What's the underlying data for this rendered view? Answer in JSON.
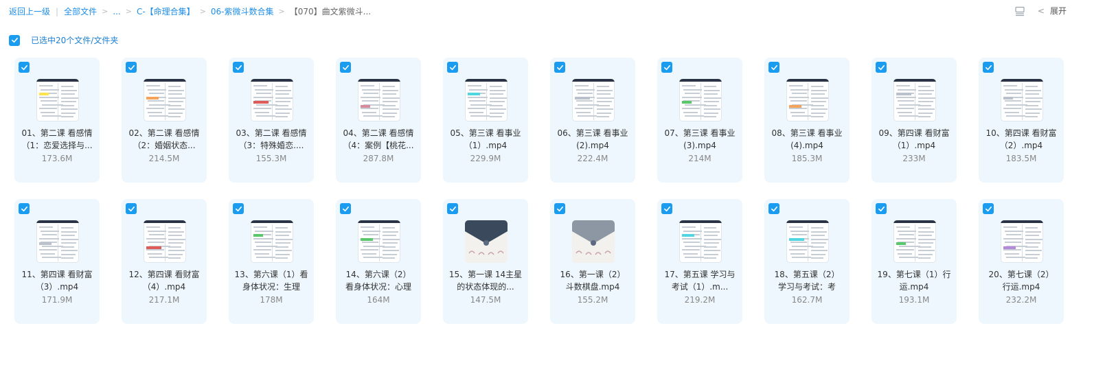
{
  "breadcrumb": {
    "back": "返回上一级",
    "all_files": "全部文件",
    "ellipsis": "...",
    "folder1": "C-【命理合集】",
    "folder2": "06-紫微斗数合集",
    "current": "【070】曲文紫微斗..."
  },
  "toolbar": {
    "expand": "展开"
  },
  "selection": {
    "text": "已选中20个文件/文件夹"
  },
  "files": [
    {
      "line1": "01、第二课 看感情",
      "line2": "（1：恋爱选择与...",
      "size": "173.6M",
      "thumb": "doc-yellow"
    },
    {
      "line1": "02、第二课 看感情",
      "line2": "（2：婚姻状态...",
      "size": "214.5M",
      "thumb": "doc-orange"
    },
    {
      "line1": "03、第二课 看感情",
      "line2": "（3：特殊婚恋....",
      "size": "155.3M",
      "thumb": "doc-red"
    },
    {
      "line1": "04、第二课 看感情",
      "line2": "（4：案例【桃花...",
      "size": "287.8M",
      "thumb": "doc-pink"
    },
    {
      "line1": "05、第三课 看事业",
      "line2": "（1）.mp4",
      "size": "229.9M",
      "thumb": "doc-cyan"
    },
    {
      "line1": "06、第三课 看事业",
      "line2": "(2).mp4",
      "size": "222.4M",
      "thumb": "doc-plain"
    },
    {
      "line1": "07、第三课 看事业",
      "line2": "(3).mp4",
      "size": "214M",
      "thumb": "doc-green"
    },
    {
      "line1": "08、第三课 看事业",
      "line2": "(4).mp4",
      "size": "185.3M",
      "thumb": "doc-orange"
    },
    {
      "line1": "09、第四课 看财富",
      "line2": "（1）.mp4",
      "size": "233M",
      "thumb": "doc-plain"
    },
    {
      "line1": "10、第四课 看财富",
      "line2": "（2）.mp4",
      "size": "183.5M",
      "thumb": "doc-plain"
    },
    {
      "line1": "11、第四课 看财富",
      "line2": "（3）.mp4",
      "size": "171.9M",
      "thumb": "doc-plain"
    },
    {
      "line1": "12、第四课 看财富",
      "line2": "（4）.mp4",
      "size": "217.1M",
      "thumb": "doc-red"
    },
    {
      "line1": "13、第六课（1）看",
      "line2": "身体状况：生理",
      "size": "178M",
      "thumb": "doc-green"
    },
    {
      "line1": "14、第六课（2）",
      "line2": "看身体状况：心理",
      "size": "164M",
      "thumb": "doc-green"
    },
    {
      "line1": "15、第一课 14主星",
      "line2": "的状态体现的...",
      "size": "147.5M",
      "thumb": "art-dark"
    },
    {
      "line1": "16、第一课（2）",
      "line2": "斗数棋盘.mp4",
      "size": "155.2M",
      "thumb": "art-grey"
    },
    {
      "line1": "17、第五课 学习与",
      "line2": "考试（1）.m...",
      "size": "219.2M",
      "thumb": "doc-cyan"
    },
    {
      "line1": "18、第五课（2）",
      "line2": "学习与考试：考",
      "size": "162.7M",
      "thumb": "doc-cyan"
    },
    {
      "line1": "19、第七课（1）行",
      "line2": "运.mp4",
      "size": "193.1M",
      "thumb": "doc-green"
    },
    {
      "line1": "20、第七课（2）",
      "line2": "行运.mp4",
      "size": "232.2M",
      "thumb": "doc-purple"
    }
  ],
  "colors": {
    "accent": "#1a9cf0",
    "card_bg": "#eef7fd",
    "link": "#1f8ee6"
  }
}
